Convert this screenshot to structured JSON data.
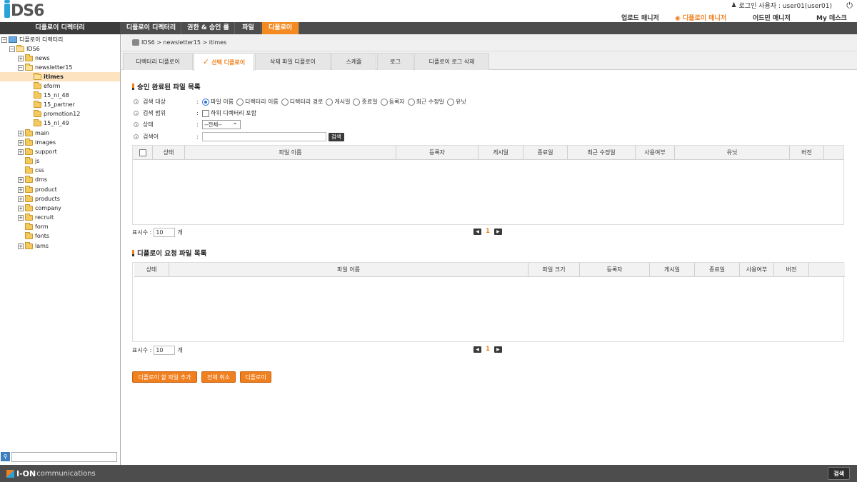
{
  "header": {
    "logo_text": "DS6",
    "login_label": "로그인 사용자 : user01(user01)",
    "top_menu": [
      {
        "label": "업로드 매니저"
      },
      {
        "label": "디플로이 매니저"
      },
      {
        "label": "어드민 매니저"
      },
      {
        "label": "My 데스크"
      }
    ]
  },
  "navbar": {
    "left_title": "디플로이 디렉터리",
    "tabs": [
      {
        "label": "디플로이 디렉터리"
      },
      {
        "label": "권한 & 승인 룰"
      },
      {
        "label": "파일"
      },
      {
        "label": "디플로이"
      }
    ]
  },
  "tree": {
    "root": "디플로이 디렉터리",
    "items": [
      {
        "label": "IDS6"
      },
      {
        "label": "news"
      },
      {
        "label": "newsletter15"
      },
      {
        "label": "itimes"
      },
      {
        "label": "eform"
      },
      {
        "label": "15_nl_48"
      },
      {
        "label": "15_partner"
      },
      {
        "label": "promotion12"
      },
      {
        "label": "15_nl_49"
      },
      {
        "label": "main"
      },
      {
        "label": "images"
      },
      {
        "label": "support"
      },
      {
        "label": "js"
      },
      {
        "label": "css"
      },
      {
        "label": "dms"
      },
      {
        "label": "product"
      },
      {
        "label": "products"
      },
      {
        "label": "company"
      },
      {
        "label": "recruit"
      },
      {
        "label": "form"
      },
      {
        "label": "fonts"
      },
      {
        "label": "lams"
      }
    ]
  },
  "breadcrumb": "IDS6 > newsletter15 > itimes",
  "subtabs": [
    {
      "label": "디렉터리 디플로이"
    },
    {
      "label": "선택 디플로이"
    },
    {
      "label": "삭제 파일 디플로이"
    },
    {
      "label": "스케쥴"
    },
    {
      "label": "로그"
    },
    {
      "label": "디플로이 로그 삭제"
    }
  ],
  "approved": {
    "title": "승인 완료된 파일 목록",
    "search_target_label": "검색 대상",
    "search_targets": [
      {
        "label": "파일 이름"
      },
      {
        "label": "디렉터리 이름"
      },
      {
        "label": "디렉터리 경로"
      },
      {
        "label": "게시일"
      },
      {
        "label": "종료일"
      },
      {
        "label": "등록자"
      },
      {
        "label": "최근 수정일"
      },
      {
        "label": "유닛"
      }
    ],
    "search_scope_label": "검색 범위",
    "include_subdirs_label": "하위 디렉터리 포함",
    "status_label": "상태",
    "status_value": "--전체--",
    "keyword_label": "검색어",
    "search_button": "검색",
    "columns": [
      "상태",
      "파일 이름",
      "등록자",
      "게시일",
      "종료일",
      "최근 수정일",
      "사용여부",
      "유닛",
      "버전"
    ],
    "count_label": "표시수 :",
    "count_value": "10",
    "count_unit": "개",
    "page": "1"
  },
  "requested": {
    "title": "디플로이 요청 파일 목록",
    "columns": [
      "상태",
      "파일 이름",
      "파일 크기",
      "등록자",
      "게시일",
      "종료일",
      "사용여부",
      "버전"
    ],
    "count_label": "표시수 :",
    "count_value": "10",
    "count_unit": "개",
    "page": "1"
  },
  "actions": {
    "add_files": "디플로이 할 파일 추가",
    "cancel_all": "전체 취소",
    "deploy": "디플로이"
  },
  "footer": {
    "logo_bold": "I-ON",
    "logo_rest": "communications",
    "search_button": "검색"
  },
  "colors": {
    "accent": "#f07f1e",
    "navbar": "#4d4d4d"
  }
}
